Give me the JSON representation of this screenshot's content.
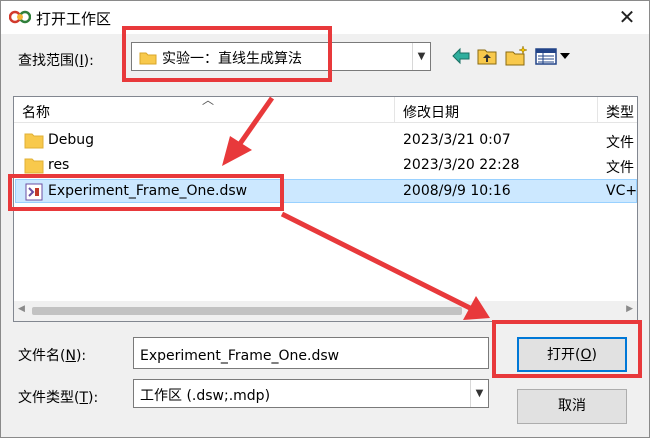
{
  "window": {
    "title": "打开工作区",
    "close_glyph": "✕"
  },
  "lookin": {
    "label_prefix": "查找范围(",
    "label_key": "I",
    "label_suffix": "):",
    "value": "实验一：直线生成算法"
  },
  "toolbar": {
    "icons": [
      "back-arrow-icon",
      "up-folder-icon",
      "new-folder-icon",
      "view-menu-icon"
    ]
  },
  "columns": {
    "name": "名称",
    "modified": "修改日期",
    "type": "类型"
  },
  "files": [
    {
      "name": "Debug",
      "modified": "2023/3/21 0:07",
      "type": "文件",
      "icon": "folder-icon"
    },
    {
      "name": "res",
      "modified": "2023/3/20 22:28",
      "type": "文件",
      "icon": "folder-icon"
    },
    {
      "name": "Experiment_Frame_One.dsw",
      "modified": "2008/9/9 10:16",
      "type": "VC+",
      "icon": "vs-workspace-icon",
      "selected": true
    }
  ],
  "filename": {
    "label_prefix": "文件名(",
    "label_key": "N",
    "label_suffix": "):",
    "value": "Experiment_Frame_One.dsw"
  },
  "filetype": {
    "label_prefix": "文件类型(",
    "label_key": "T",
    "label_suffix": "):",
    "value": "工作区 (.dsw;.mdp)"
  },
  "buttons": {
    "open_prefix": "打开(",
    "open_key": "O",
    "open_suffix": ")",
    "cancel": "取消"
  },
  "colors": {
    "annotation": "#e8393b",
    "selection": "#cce8ff",
    "folder": "#f8c94c",
    "accent": "#0078d7"
  }
}
